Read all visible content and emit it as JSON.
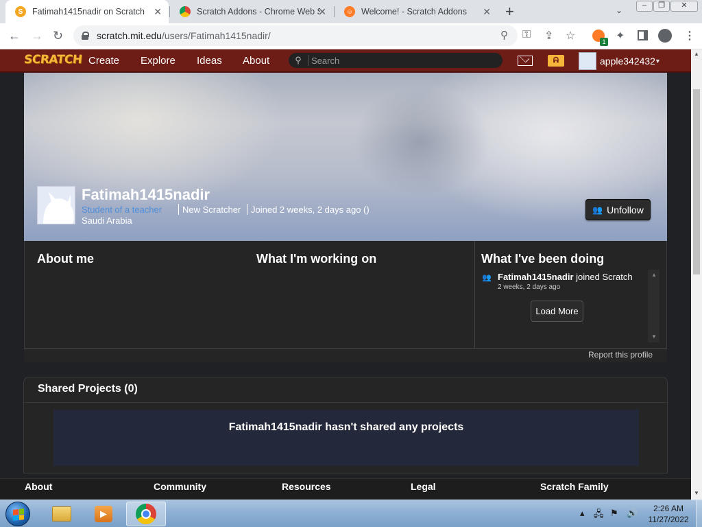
{
  "browser": {
    "tabs": [
      {
        "title": "Fatimah1415nadir on Scratch",
        "active": true
      },
      {
        "title": "Scratch Addons - Chrome Web S",
        "active": false
      },
      {
        "title": "Welcome! - Scratch Addons",
        "active": false
      }
    ],
    "new_tab_icon": "+",
    "window_controls": {
      "minimize": "–",
      "maximize": "❐",
      "close": "✕"
    },
    "url_host": "scratch.mit.edu",
    "url_path": "/users/Fatimah1415nadir/",
    "extension_badge": "1"
  },
  "scratch_nav": {
    "logo": "SCRATCH",
    "links": [
      "Create",
      "Explore",
      "Ideas",
      "About"
    ],
    "search_placeholder": "Search",
    "username": "apple342432"
  },
  "profile": {
    "username": "Fatimah1415nadir",
    "role": "Student of a teacher",
    "rank": "New Scratcher",
    "joined": "Joined 2 weeks, 2 days ago ()",
    "country": "Saudi Arabia",
    "unfollow_label": "Unfollow"
  },
  "sections": {
    "about_me": "About me",
    "working_on": "What I'm working on",
    "been_doing": "What I've been doing"
  },
  "activity": {
    "user": "Fatimah1415nadir",
    "action": "joined Scratch",
    "time": "2 weeks, 2 days ago",
    "load_more": "Load More"
  },
  "report_label": "Report this profile",
  "shared_projects": {
    "title": "Shared Projects (0)",
    "empty_message": "Fatimah1415nadir hasn't shared any projects"
  },
  "footer": [
    "About",
    "Community",
    "Resources",
    "Legal",
    "Scratch Family"
  ],
  "taskbar": {
    "time": "2:26 AM",
    "date": "11/27/2022"
  }
}
